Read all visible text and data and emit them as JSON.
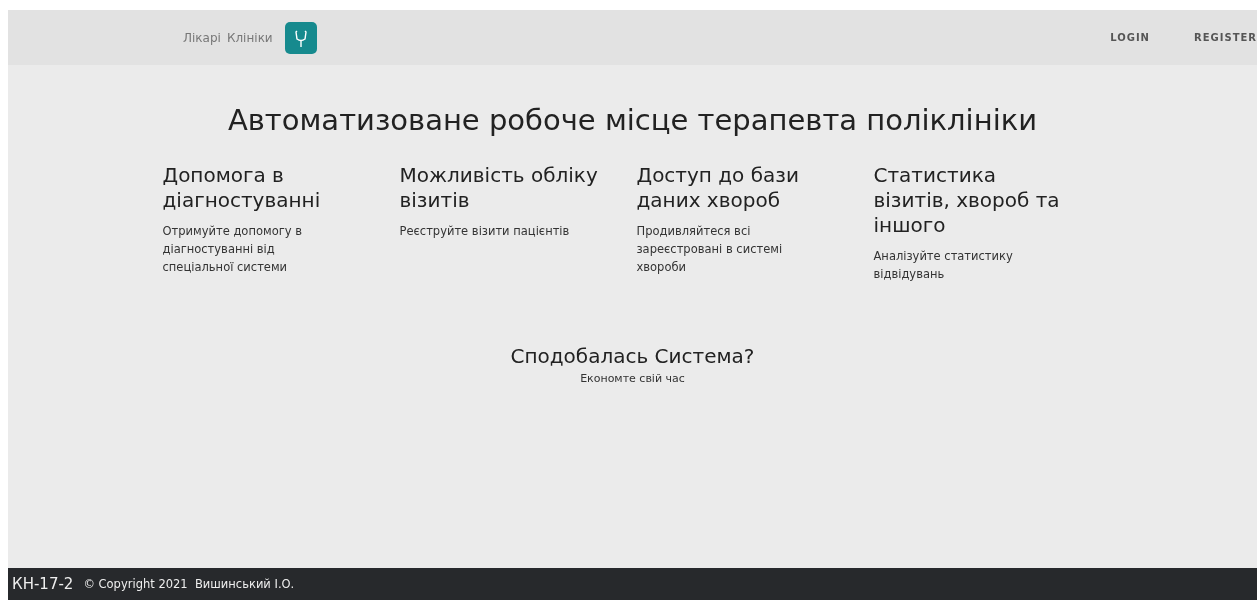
{
  "navbar": {
    "links": [
      "Лікарі",
      "Клініки"
    ],
    "auth_links": [
      "LOGIN",
      "REGISTER"
    ]
  },
  "title": "Автоматизоване робоче місце терапевта поліклініки",
  "features": [
    {
      "heading": "Допомога в діагностуванні",
      "text": "Отримуйте допомогу в діагностуванні від спеціальної системи"
    },
    {
      "heading": "Можливість обліку візитів",
      "text": "Реєструйте візити пацієнтів"
    },
    {
      "heading": "Доступ до бази даних хвороб",
      "text": "Продивляйтеся всі зареєстровані в системі хвороби"
    },
    {
      "heading": "Статистика візитів, хвороб та іншого",
      "text": "Аналізуйте статистику відвідувань"
    }
  ],
  "cta": {
    "heading": "Сподобалась Система?",
    "text": "Економте свій час"
  },
  "footer": {
    "brand": "КН-17-2",
    "copyright": "© Copyright 2021  Вишинський І.О."
  }
}
